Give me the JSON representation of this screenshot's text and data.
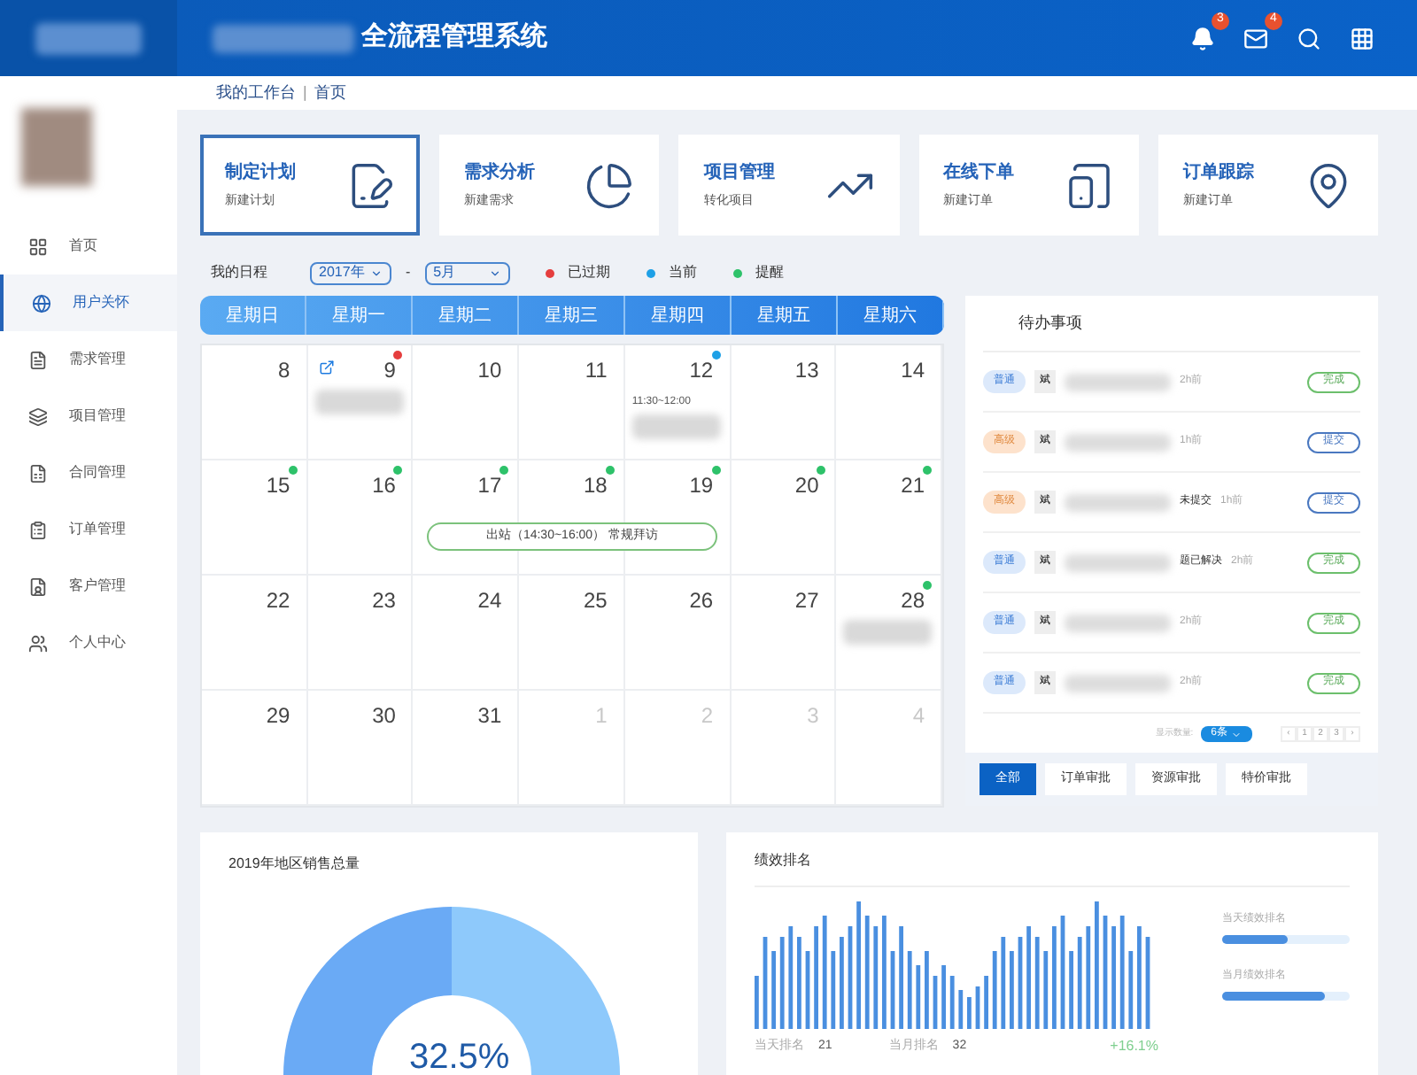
{
  "header": {
    "title": "全流程管理系统",
    "notifications": "3",
    "messages": "4"
  },
  "sidebar": {
    "items": [
      {
        "label": "首页",
        "selected": false
      },
      {
        "label": "用户关怀",
        "selected": true
      },
      {
        "label": "需求管理",
        "selected": false
      },
      {
        "label": "项目管理",
        "selected": false
      },
      {
        "label": "合同管理",
        "selected": false
      },
      {
        "label": "订单管理",
        "selected": false
      },
      {
        "label": "客户管理",
        "selected": false
      },
      {
        "label": "个人中心",
        "selected": false
      }
    ]
  },
  "breadcrumb": {
    "items": [
      "我的工作台",
      "首页"
    ],
    "separator": "|"
  },
  "shortcuts": [
    {
      "title": "制定计划",
      "subtitle": "新建计划",
      "selected": true
    },
    {
      "title": "需求分析",
      "subtitle": "新建需求",
      "selected": false
    },
    {
      "title": "项目管理",
      "subtitle": "转化项目",
      "selected": false
    },
    {
      "title": "在线下单",
      "subtitle": "新建订单",
      "selected": false
    },
    {
      "title": "订单跟踪",
      "subtitle": "新建订单",
      "selected": false
    }
  ],
  "schedule": {
    "label": "我的日程",
    "year": "2017年",
    "month": "5月",
    "separator": "-",
    "legend": [
      {
        "label": "已过期",
        "color": "#e53e3e"
      },
      {
        "label": "当前",
        "color": "#1ea0e6"
      },
      {
        "label": "提醒",
        "color": "#2ec26a"
      }
    ]
  },
  "calendar": {
    "weekdays": [
      "星期日",
      "星期一",
      "星期二",
      "星期三",
      "星期四",
      "星期五",
      "星期六"
    ],
    "days": [
      {
        "day": "8",
        "muted": false
      },
      {
        "day": "9",
        "muted": false,
        "color": "#e53e3e",
        "link": true,
        "blurred": true
      },
      {
        "day": "10",
        "muted": false
      },
      {
        "day": "11",
        "muted": false
      },
      {
        "day": "12",
        "muted": false,
        "color": "#1ea0e6",
        "time": "11:30~12:00",
        "blurred": true
      },
      {
        "day": "13",
        "muted": false
      },
      {
        "day": "14",
        "muted": false
      },
      {
        "day": "15",
        "muted": false,
        "color": "#2ec26a"
      },
      {
        "day": "16",
        "muted": false,
        "color": "#2ec26a"
      },
      {
        "day": "17",
        "muted": false,
        "color": "#2ec26a"
      },
      {
        "day": "18",
        "muted": false,
        "color": "#2ec26a"
      },
      {
        "day": "19",
        "muted": false,
        "color": "#2ec26a"
      },
      {
        "day": "20",
        "muted": false,
        "color": "#2ec26a"
      },
      {
        "day": "21",
        "muted": false,
        "color": "#2ec26a"
      },
      {
        "day": "22",
        "muted": false
      },
      {
        "day": "23",
        "muted": false
      },
      {
        "day": "24",
        "muted": false
      },
      {
        "day": "25",
        "muted": false
      },
      {
        "day": "26",
        "muted": false
      },
      {
        "day": "27",
        "muted": false
      },
      {
        "day": "28",
        "muted": false,
        "color": "#2ec26a",
        "blurred": true
      },
      {
        "day": "29",
        "muted": false
      },
      {
        "day": "30",
        "muted": false
      },
      {
        "day": "31",
        "muted": false
      },
      {
        "day": "1",
        "muted": true
      },
      {
        "day": "2",
        "muted": true
      },
      {
        "day": "3",
        "muted": true
      },
      {
        "day": "4",
        "muted": true
      }
    ],
    "event": "出站（14:30~16:00） 常规拜访"
  },
  "todo": {
    "title": "待办事项",
    "items": [
      {
        "level": "普通",
        "kind": "normal",
        "avatar": "斌",
        "time": "2h前",
        "action": {
          "label": "完成",
          "kind": "done"
        }
      },
      {
        "level": "高级",
        "kind": "high",
        "avatar": "斌",
        "time": "1h前",
        "action": {
          "label": "提交",
          "kind": "submit"
        }
      },
      {
        "level": "高级",
        "kind": "high",
        "avatar": "斌",
        "text": "未提交",
        "time": "1h前",
        "action": {
          "label": "提交",
          "kind": "submit"
        }
      },
      {
        "level": "普通",
        "kind": "normal",
        "avatar": "斌",
        "text": "题已解决",
        "time": "2h前",
        "action": {
          "label": "完成",
          "kind": "done"
        }
      },
      {
        "level": "普通",
        "kind": "normal",
        "avatar": "斌",
        "time": "2h前",
        "action": {
          "label": "完成",
          "kind": "done"
        }
      },
      {
        "level": "普通",
        "kind": "normal",
        "avatar": "斌",
        "time": "2h前",
        "action": {
          "label": "完成",
          "kind": "done"
        }
      }
    ],
    "count_label": "显示数量:",
    "count": "6条",
    "pages": [
      {
        "label": "‹",
        "selected": false
      },
      {
        "label": "1",
        "selected": false
      },
      {
        "label": "2",
        "selected": false
      },
      {
        "label": "3",
        "selected": false
      },
      {
        "label": "›",
        "selected": false
      }
    ],
    "tabs": [
      {
        "label": "全部",
        "selected": true
      },
      {
        "label": "订单审批",
        "selected": false
      },
      {
        "label": "资源审批",
        "selected": false
      },
      {
        "label": "特价审批",
        "selected": false
      }
    ]
  },
  "sales": {
    "title": "2019年地区销售总量",
    "percent": "32.5%"
  },
  "performance": {
    "title": "绩效排名",
    "day_label": "当天排名",
    "day_value": "21",
    "month_label": "当月排名",
    "month_value": "32",
    "change": "+16.1%",
    "meters": [
      {
        "label": "当天绩效排名",
        "level": 0.52
      },
      {
        "label": "当月绩效排名",
        "level": 0.8
      }
    ]
  }
}
